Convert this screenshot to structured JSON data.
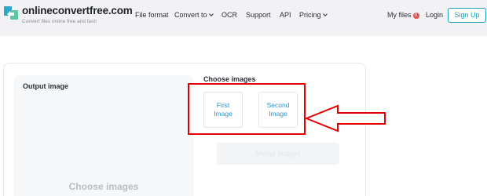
{
  "header": {
    "brand": "onlineconvertfree.com",
    "tagline": "Convert files online free and fast!",
    "nav": [
      {
        "label": "File format",
        "dropdown": false
      },
      {
        "label": "Convert to",
        "dropdown": true
      },
      {
        "label": "OCR",
        "dropdown": false
      },
      {
        "label": "Support",
        "dropdown": false
      },
      {
        "label": "API",
        "dropdown": false
      },
      {
        "label": "Pricing",
        "dropdown": true
      }
    ],
    "my_files": "My files",
    "my_files_count": "0",
    "login": "Login",
    "signup": "Sign Up",
    "accent_color": "#1da1b8",
    "logo_icon": "convert-arrows-logo"
  },
  "main": {
    "output_title": "Output image",
    "output_placeholder": "Choose images",
    "choose_title": "Choose images",
    "slots": [
      {
        "line1": "First",
        "line2": "Image"
      },
      {
        "line1": "Second",
        "line2": "Image"
      }
    ],
    "action_button": "Merge images"
  },
  "annotation": {
    "highlight_color": "#e00000",
    "arrow_icon": "left-arrow-annotation"
  }
}
